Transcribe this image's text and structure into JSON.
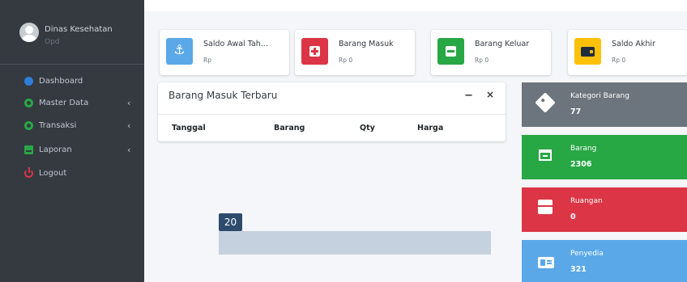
{
  "user": {
    "name": "Dinas Kesehatan",
    "role": "Opd"
  },
  "sidebar": {
    "items": [
      {
        "label": "Dashboard",
        "icon": "dashboard-icon",
        "has_chevron": false
      },
      {
        "label": "Master Data",
        "icon": "gear-icon",
        "has_chevron": true
      },
      {
        "label": "Transaksi",
        "icon": "gear-icon",
        "has_chevron": true
      },
      {
        "label": "Laporan",
        "icon": "report-icon",
        "has_chevron": true
      },
      {
        "label": "Logout",
        "icon": "power-icon",
        "has_chevron": false
      }
    ],
    "chevron": "‹"
  },
  "info_boxes": [
    {
      "title": "Saldo Awal Tah...",
      "value": "Rp",
      "color": "#5aa8e8",
      "icon": "anchor-icon"
    },
    {
      "title": "Barang Masuk",
      "value": "Rp 0",
      "color": "#dc3545",
      "icon": "plus-square-icon"
    },
    {
      "title": "Barang Keluar",
      "value": "Rp 0",
      "color": "#28a745",
      "icon": "minus-square-icon"
    },
    {
      "title": "Saldo Akhir",
      "value": "Rp 0",
      "color": "#ffc107",
      "icon": "wallet-icon"
    }
  ],
  "card": {
    "title": "Barang Masuk Terbaru",
    "minimize": "−",
    "close": "×",
    "columns": [
      "Tanggal",
      "Barang",
      "Qty",
      "Harga"
    ]
  },
  "small_boxes": [
    {
      "label": "Kategori Barang",
      "value": "77",
      "color": "#6c757d",
      "icon": "tag-icon"
    },
    {
      "label": "Barang",
      "value": "2306",
      "color": "#28a745",
      "icon": "archive-icon"
    },
    {
      "label": "Ruangan",
      "value": "0",
      "color": "#dc3545",
      "icon": "box-icon"
    },
    {
      "label": "Penyedia",
      "value": "321",
      "color": "#5aa8e8",
      "icon": "id-card-icon"
    }
  ],
  "overlay": {
    "badge": "20"
  }
}
